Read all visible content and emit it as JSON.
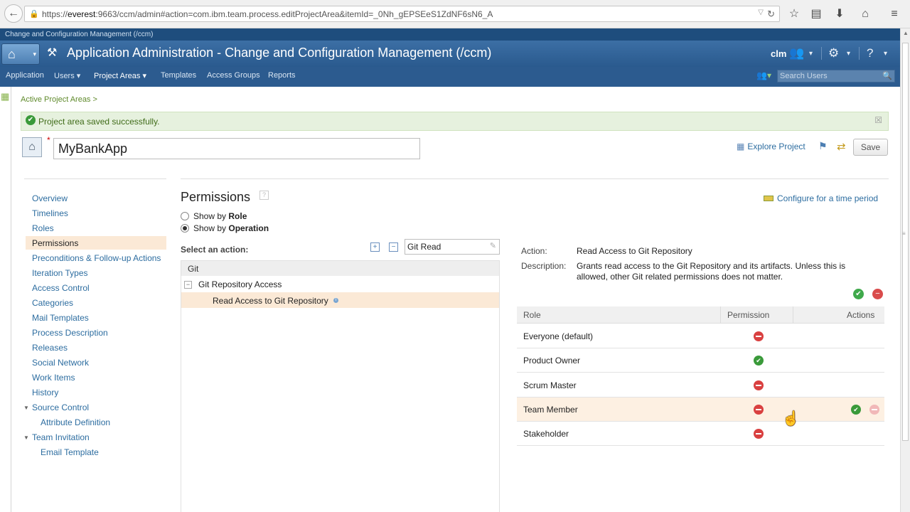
{
  "browser": {
    "url_prefix": "https://",
    "url_host": "everest",
    "url_rest": ":9663/ccm/admin#action=com.ibm.team.process.editProjectArea&itemId=_0Nh_gEPSEeS1ZdNF6sN6_A"
  },
  "header": {
    "context": "Change and Configuration Management (/ccm)",
    "title": "Application Administration - Change and Configuration Management (/ccm)",
    "user": "clm"
  },
  "nav": {
    "items": [
      "Application",
      "Users",
      "Project Areas",
      "Templates",
      "Access Groups",
      "Reports"
    ],
    "search_placeholder": "Search Users"
  },
  "breadcrumb": "Active Project Areas >",
  "notification": "Project area saved successfully.",
  "project_area": {
    "name": "MyBankApp",
    "explore_label": "Explore Project",
    "save_label": "Save"
  },
  "left_nav": [
    "Overview",
    "Timelines",
    "Roles",
    "Permissions",
    "Preconditions & Follow-up Actions",
    "Iteration Types",
    "Access Control",
    "Categories",
    "Mail Templates",
    "Process Description",
    "Releases",
    "Social Network",
    "Work Items",
    "History",
    "Source Control",
    "Attribute Definition",
    "Team Invitation",
    "Email Template"
  ],
  "permissions": {
    "title": "Permissions",
    "configure_label": "Configure for a time period",
    "show_by": "Show by",
    "role_option": "Role",
    "operation_option": "Operation",
    "select_action_label": "Select an action:",
    "filter_value": "Git Read",
    "tree": {
      "root": "Git",
      "group": "Git Repository Access",
      "leaf": "Read Access to Git Repository"
    },
    "detail": {
      "action_label": "Action:",
      "action_value": "Read Access to Git Repository",
      "description_label": "Description:",
      "description_line1": "Grants read access to the Git Repository and its artifacts. Unless this is",
      "description_line2": "allowed, other Git related permissions does not matter."
    },
    "table": {
      "headers": [
        "Role",
        "Permission",
        "Actions"
      ],
      "rows": [
        {
          "role": "Everyone (default)",
          "permission": "deny"
        },
        {
          "role": "Product Owner",
          "permission": "allow"
        },
        {
          "role": "Scrum Master",
          "permission": "deny"
        },
        {
          "role": "Team Member",
          "permission": "deny"
        },
        {
          "role": "Stakeholder",
          "permission": "deny"
        }
      ]
    }
  }
}
